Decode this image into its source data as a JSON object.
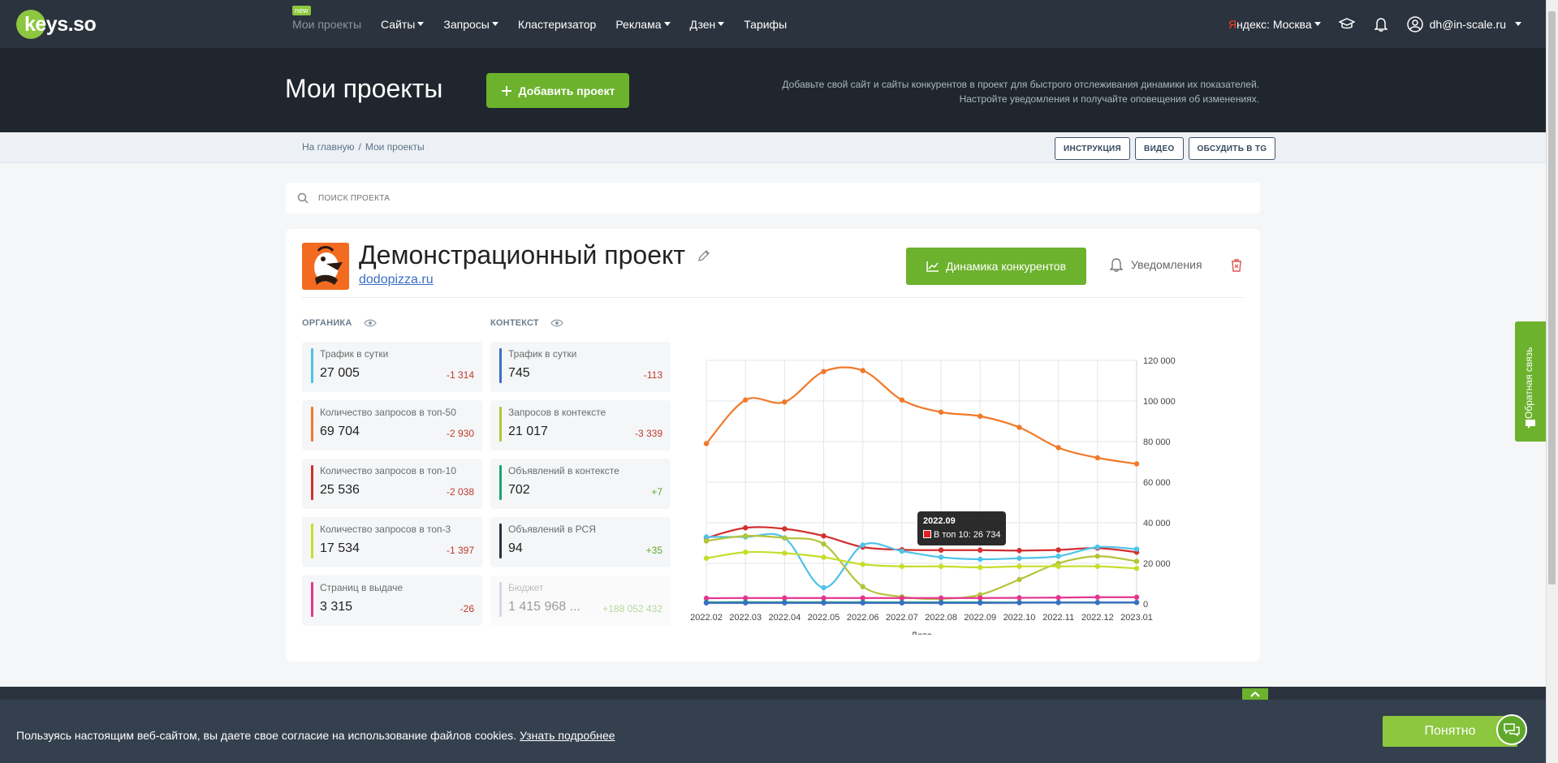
{
  "nav": {
    "logo": "keys.so",
    "new_badge": "new",
    "items": [
      {
        "label": "Мои проекты",
        "dropdown": false,
        "active": true
      },
      {
        "label": "Сайты",
        "dropdown": true
      },
      {
        "label": "Запросы",
        "dropdown": true
      },
      {
        "label": "Кластеризатор",
        "dropdown": false
      },
      {
        "label": "Реклама",
        "dropdown": true
      },
      {
        "label": "Дзен",
        "dropdown": true
      },
      {
        "label": "Тарифы",
        "dropdown": false
      }
    ],
    "region_prefix": "Я",
    "region": "ндекс: Москва",
    "user": "dh@in-scale.ru"
  },
  "header": {
    "title": "Мои проекты",
    "add_button": "Добавить проект",
    "desc_line1": "Добавьте свой сайт и сайты конкурентов в проект для быстрого отслеживания динамики их показателей.",
    "desc_line2": "Настройте уведомления и получайте оповещения об изменениях."
  },
  "breadcrumbs": {
    "home": "На главную",
    "sep": "/",
    "current": "Мои проекты",
    "buttons": [
      "ИНСТРУКЦИЯ",
      "ВИДЕО",
      "ОБСУДИТЬ В TG"
    ]
  },
  "search": {
    "placeholder": "ПОИСК ПРОЕКТА"
  },
  "project": {
    "title": "Демонстрационный проект",
    "domain": "dodopizza.ru",
    "dynamics_button": "Динамика конкурентов",
    "notifications": "Уведомления",
    "organic_label": "ОРГАНИКА",
    "context_label": "КОНТЕКСТ",
    "organic": [
      {
        "label": "Трафик в сутки",
        "value": "27 005",
        "delta": "-1 314",
        "color": "#4fc3e8",
        "sign": "neg"
      },
      {
        "label": "Количество запросов в топ-50",
        "value": "69 704",
        "delta": "-2 930",
        "color": "#f07a29",
        "sign": "neg"
      },
      {
        "label": "Количество запросов в топ-10",
        "value": "25 536",
        "delta": "-2 038",
        "color": "#d32f2f",
        "sign": "neg"
      },
      {
        "label": "Количество запросов в топ-3",
        "value": "17 534",
        "delta": "-1 397",
        "color": "#c6de2b",
        "sign": "neg"
      },
      {
        "label": "Страниц в выдаче",
        "value": "3 315",
        "delta": "-26",
        "color": "#e5368f",
        "sign": "neg"
      }
    ],
    "context": [
      {
        "label": "Трафик в сутки",
        "value": "745",
        "delta": "-113",
        "color": "#3a6fc4",
        "sign": "neg"
      },
      {
        "label": "Запросов в контексте",
        "value": "21 017",
        "delta": "-3 339",
        "color": "#b5c43a",
        "sign": "neg"
      },
      {
        "label": "Объявлений в контексте",
        "value": "702",
        "delta": "+7",
        "color": "#1aa36b",
        "sign": "pos"
      },
      {
        "label": "Объявлений в РСЯ",
        "value": "94",
        "delta": "+35",
        "color": "#2b333e",
        "sign": "pos"
      },
      {
        "label": "Бюджет",
        "value": "1 415 968 ...",
        "delta": "+188 052 432",
        "color": "#b79ccf",
        "sign": "pos",
        "faded": true
      }
    ]
  },
  "chart_data": {
    "type": "line",
    "x": [
      "2022.02",
      "2022.03",
      "2022.04",
      "2022.05",
      "2022.06",
      "2022.07",
      "2022.08",
      "2022.09",
      "2022.10",
      "2022.11",
      "2022.12",
      "2023.01"
    ],
    "xlabel": "Дата",
    "ylim": [
      0,
      120000
    ],
    "yticks": [
      "0",
      "20 000",
      "40 000",
      "60 000",
      "80 000",
      "100 000",
      "120 000"
    ],
    "grid": true,
    "series": [
      {
        "color": "#f07a29",
        "values": [
          79000,
          100500,
          99500,
          114500,
          115000,
          100500,
          94500,
          92500,
          87000,
          77000,
          72000,
          69000
        ]
      },
      {
        "color": "#d32f2f",
        "values": [
          32500,
          37500,
          37000,
          33500,
          28000,
          26700,
          26500,
          26500,
          26300,
          26600,
          27500,
          25500
        ]
      },
      {
        "color": "#4fc3e8",
        "values": [
          33000,
          33000,
          32500,
          8000,
          29000,
          26000,
          23000,
          22000,
          22500,
          23500,
          28000,
          27000
        ]
      },
      {
        "color": "#b5c43a",
        "values": [
          31000,
          33500,
          32500,
          29500,
          8500,
          3500,
          2500,
          4500,
          12000,
          20000,
          23500,
          21000
        ]
      },
      {
        "color": "#c6de2b",
        "values": [
          22500,
          25500,
          25000,
          23000,
          19500,
          18500,
          18500,
          18000,
          18500,
          18500,
          18500,
          17500
        ]
      },
      {
        "color": "#e5368f",
        "values": [
          2800,
          2900,
          2900,
          2900,
          2900,
          2900,
          2900,
          2900,
          3000,
          3100,
          3300,
          3300
        ]
      },
      {
        "color": "#1aa36b",
        "values": [
          800,
          850,
          800,
          800,
          800,
          750,
          750,
          750,
          700,
          700,
          700,
          700
        ]
      },
      {
        "color": "#3a6fc4",
        "values": [
          500,
          500,
          500,
          500,
          500,
          500,
          500,
          500,
          600,
          700,
          700,
          745
        ]
      }
    ],
    "tooltip": {
      "title": "2022.09",
      "label": "В топ 10: 26 734"
    }
  },
  "cookie": {
    "text": "Пользуясь настоящим веб-сайтом, вы даете свое согласие на использование файлов cookies.",
    "link": "Узнать подробнее",
    "ok": "Понятно"
  },
  "feedback": "Обратная связь"
}
